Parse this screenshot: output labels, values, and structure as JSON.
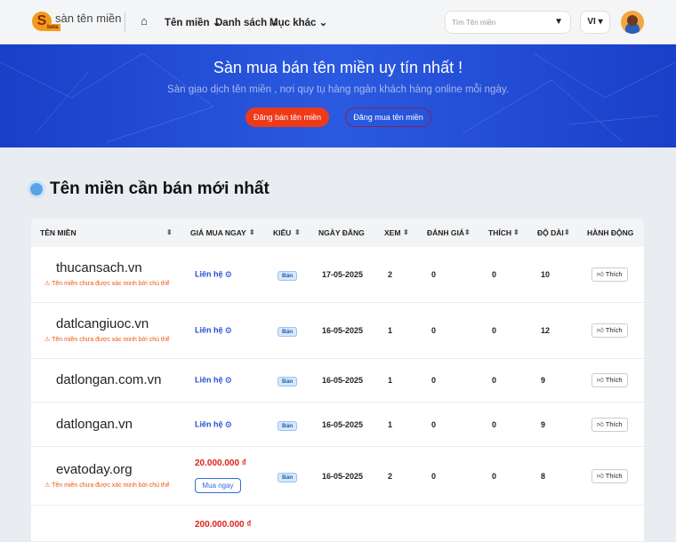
{
  "nav": {
    "logo_text": "sàn tên miền",
    "logo_badge": "beta",
    "menu": [
      "Tên miền",
      "Danh sách",
      "Mục khác"
    ],
    "search_placeholder": "Tìm Tên miền",
    "lang": "VI"
  },
  "hero": {
    "title": "Sàn mua bán tên miền uy tín nhất !",
    "subtitle": "Sàn giao dịch tên miền , nơi quy tụ hàng ngàn khách hàng online mỗi ngày.",
    "sell_button": "Đăng bán tên miền",
    "buy_button": "Đăng mua tên miền"
  },
  "section_title": "Tên miền cần bán mới nhất",
  "columns": [
    "TÊN MIỀN",
    "GIÁ MUA NGAY",
    "KIỂU",
    "NGÀY ĐĂNG",
    "XEM",
    "ĐÁNH GIÁ",
    "THÍCH",
    "ĐỘ DÀI",
    "HÀNH ĐỘNG"
  ],
  "warning": "Tên miền chưa được xác minh bởi chủ thể",
  "contact": "Liên hệ",
  "buy_now": "Mua ngay",
  "like": "Thích",
  "type": "Bán",
  "rows": [
    {
      "domain": "thucansach.vn",
      "warn": true,
      "price": "",
      "date": "17-05-2025",
      "views": "2",
      "rating": "0",
      "likes": "0",
      "length": "10"
    },
    {
      "domain": "datlcangiuoc.vn",
      "warn": true,
      "price": "",
      "date": "16-05-2025",
      "views": "1",
      "rating": "0",
      "likes": "0",
      "length": "12"
    },
    {
      "domain": "datlongan.com.vn",
      "warn": false,
      "price": "",
      "date": "16-05-2025",
      "views": "1",
      "rating": "0",
      "likes": "0",
      "length": "9"
    },
    {
      "domain": "datlongan.vn",
      "warn": false,
      "price": "",
      "date": "16-05-2025",
      "views": "1",
      "rating": "0",
      "likes": "0",
      "length": "9"
    },
    {
      "domain": "evatoday.org",
      "warn": true,
      "price": "20.000.000 ₫",
      "date": "16-05-2025",
      "views": "2",
      "rating": "0",
      "likes": "0",
      "length": "8"
    }
  ],
  "partial_row_price": "200.000.000 ₫"
}
